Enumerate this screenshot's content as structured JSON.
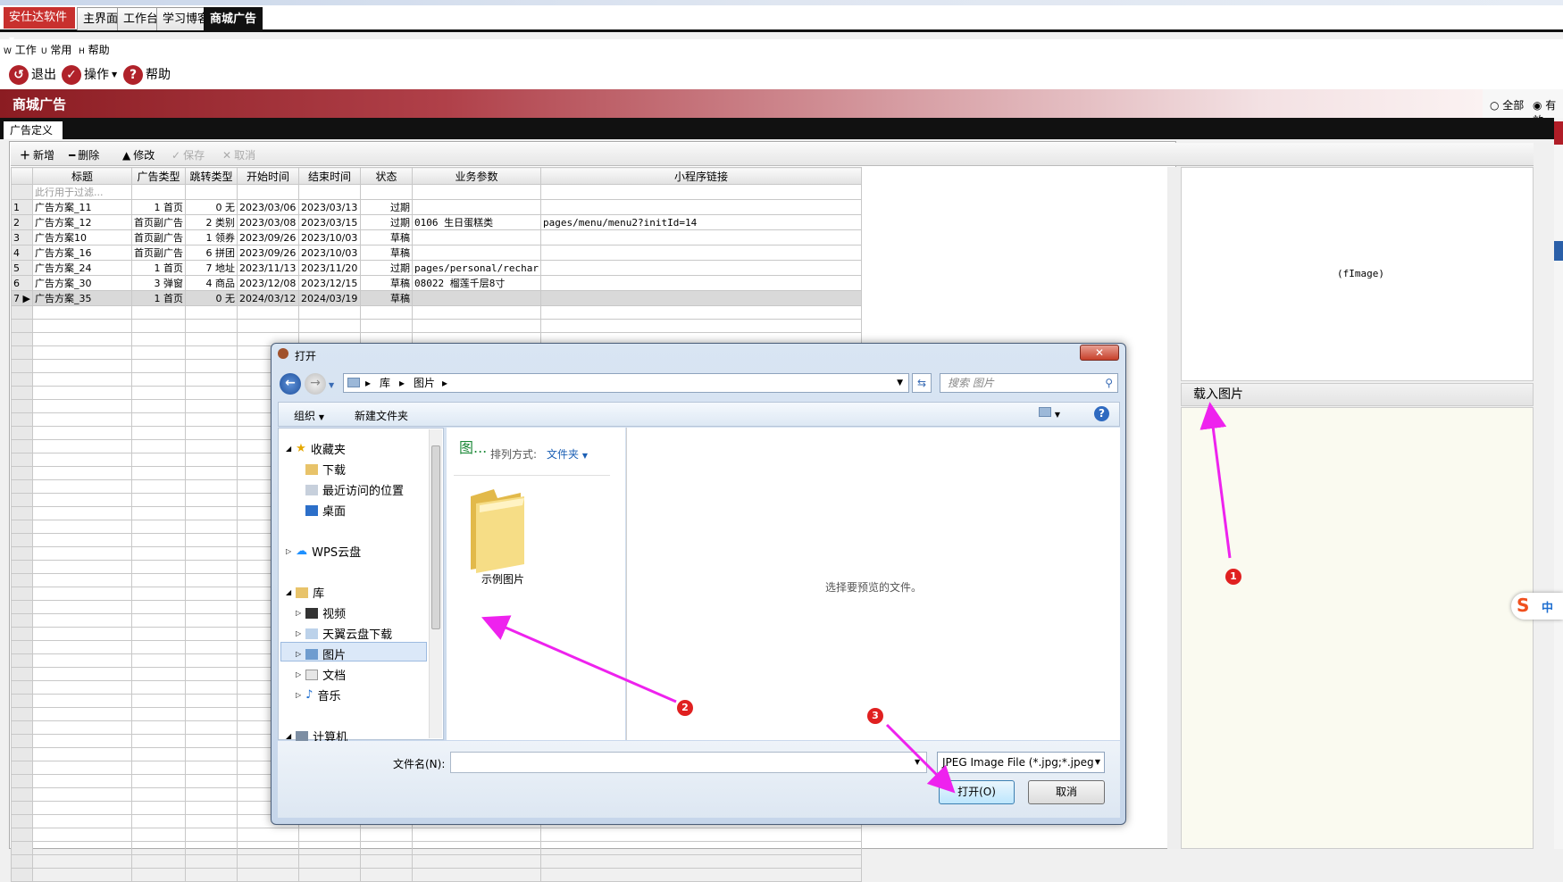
{
  "app": {
    "menu_button": "安仕达软件",
    "tabs": [
      "主界面",
      "工作台",
      "学习博客",
      "商城广告"
    ],
    "active_tab": 3
  },
  "menu": {
    "work": "工作",
    "common": "常用",
    "help": "帮助",
    "work_key": "W",
    "common_key": "U",
    "help_key": "H"
  },
  "toolbar": {
    "exit": "退出",
    "operate": "操作",
    "help": "帮助"
  },
  "page": {
    "title": "商城广告",
    "radio_all": "全部",
    "radio_valid": "有效",
    "subtab": "广告定义"
  },
  "grid_toolbar": {
    "add": "新增",
    "delete": "删除",
    "edit": "修改",
    "save": "保存",
    "cancel": "取消"
  },
  "grid": {
    "columns": [
      "标题",
      "广告类型",
      "跳转类型",
      "开始时间",
      "结束时间",
      "状态",
      "业务参数",
      "小程序链接"
    ],
    "filter_hint": "此行用于过滤...",
    "rows": [
      {
        "no": "1",
        "title": "广告方案_11",
        "ad_type_num": "1",
        "ad_type": "首页",
        "jump_num": "0",
        "jump": "无",
        "start": "2023/03/06",
        "end": "2023/03/13",
        "status": "过期",
        "param": "",
        "link": ""
      },
      {
        "no": "2",
        "title": "广告方案_12",
        "ad_type_num": "",
        "ad_type": "首页副广告",
        "jump_num": "2",
        "jump": "类别",
        "start": "2023/03/08",
        "end": "2023/03/15",
        "status": "过期",
        "param": "0106 生日蛋糕类",
        "link": "pages/menu/menu2?initId=14"
      },
      {
        "no": "3",
        "title": "广告方案10",
        "ad_type_num": "",
        "ad_type": "首页副广告",
        "jump_num": "1",
        "jump": "领券",
        "start": "2023/09/26",
        "end": "2023/10/03",
        "status": "草稿",
        "param": "",
        "link": ""
      },
      {
        "no": "4",
        "title": "广告方案_16",
        "ad_type_num": "",
        "ad_type": "首页副广告",
        "jump_num": "6",
        "jump": "拼团",
        "start": "2023/09/26",
        "end": "2023/10/03",
        "status": "草稿",
        "param": "",
        "link": ""
      },
      {
        "no": "5",
        "title": "广告方案_24",
        "ad_type_num": "1",
        "ad_type": "首页",
        "jump_num": "7",
        "jump": "地址",
        "start": "2023/11/13",
        "end": "2023/11/20",
        "status": "过期",
        "param": "pages/personal/rechar",
        "link": ""
      },
      {
        "no": "6",
        "title": "广告方案_30",
        "ad_type_num": "3",
        "ad_type": "弹窗",
        "jump_num": "4",
        "jump": "商品",
        "start": "2023/12/08",
        "end": "2023/12/15",
        "status": "草稿",
        "param": "08022 榴莲千层8寸",
        "link": ""
      },
      {
        "no": "7",
        "title": "广告方案_35",
        "ad_type_num": "1",
        "ad_type": "首页",
        "jump_num": "0",
        "jump": "无",
        "start": "2024/03/12",
        "end": "2024/03/19",
        "status": "草稿",
        "param": "",
        "link": ""
      }
    ]
  },
  "image_panel": {
    "placeholder": "(fImage)",
    "load_label": "载入图片"
  },
  "dialog": {
    "title": "打开",
    "breadcrumb": [
      "库",
      "图片"
    ],
    "search_placeholder": "搜索 图片",
    "organize": "组织",
    "new_folder": "新建文件夹",
    "nav": {
      "favorites": "收藏夹",
      "downloads": "下载",
      "recent": "最近访问的位置",
      "desktop": "桌面",
      "wps": "WPS云盘",
      "libraries": "库",
      "videos": "视频",
      "tianyi": "天翼云盘下载",
      "pictures": "图片",
      "documents": "文档",
      "music": "音乐",
      "computer": "计算机"
    },
    "library_heading": "图...",
    "arrange_label": "排列方式:",
    "arrange_value": "文件夹",
    "folder_name": "示例图片",
    "preview_text": "选择要预览的文件。",
    "filename_label": "文件名(N):",
    "filename_value": "",
    "filetype": "JPEG Image File (*.jpg;*.jpeg",
    "open_button": "打开(O)",
    "cancel_button": "取消"
  },
  "annotations": {
    "badge1": "1",
    "badge2": "2",
    "badge3": "3",
    "arrow_color": "#ee22ee"
  },
  "ime": {
    "label": "中"
  }
}
